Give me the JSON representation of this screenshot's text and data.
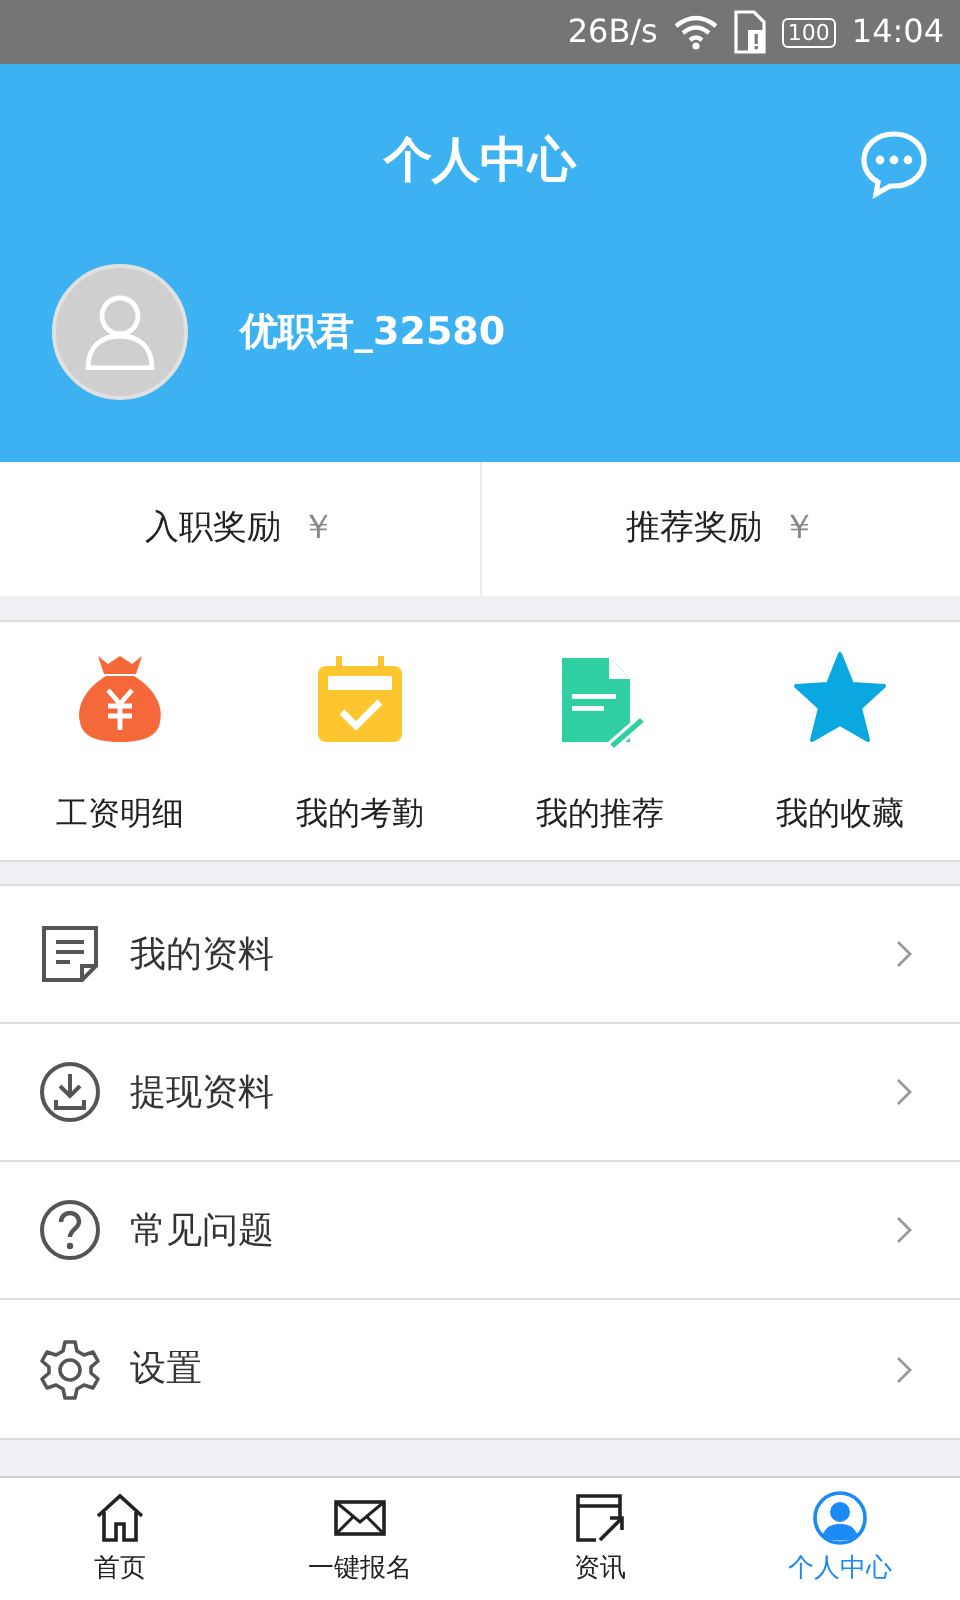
{
  "status_bar": {
    "speed": "26B/s",
    "battery": "100",
    "time": "14:04"
  },
  "header": {
    "title": "个人中心",
    "username": "优职君_32580"
  },
  "rewards": [
    {
      "label": "入职奖励",
      "currency": "￥"
    },
    {
      "label": "推荐奖励",
      "currency": "￥"
    }
  ],
  "shortcuts": [
    {
      "kind": "moneybag",
      "label": "工资明细"
    },
    {
      "kind": "calendar",
      "label": "我的考勤"
    },
    {
      "kind": "document",
      "label": "我的推荐"
    },
    {
      "kind": "star",
      "label": "我的收藏"
    }
  ],
  "menu": [
    {
      "kind": "profile",
      "label": "我的资料"
    },
    {
      "kind": "download",
      "label": "提现资料"
    },
    {
      "kind": "question",
      "label": "常见问题"
    },
    {
      "kind": "settings",
      "label": "设置"
    }
  ],
  "tabs": [
    {
      "kind": "home",
      "label": "首页",
      "selected": false
    },
    {
      "kind": "mail",
      "label": "一键报名",
      "selected": false
    },
    {
      "kind": "news",
      "label": "资讯",
      "selected": false
    },
    {
      "kind": "person",
      "label": "个人中心",
      "selected": true
    }
  ]
}
